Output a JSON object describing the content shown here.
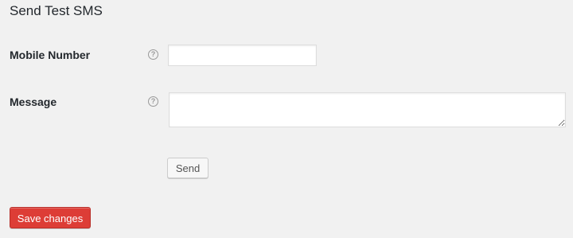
{
  "section": {
    "title": "Send Test SMS"
  },
  "fields": {
    "mobile": {
      "label": "Mobile Number",
      "help": "?",
      "value": "",
      "placeholder": ""
    },
    "message": {
      "label": "Message",
      "help": "?",
      "value": "",
      "placeholder": ""
    }
  },
  "actions": {
    "send_label": "Send",
    "save_label": "Save changes"
  },
  "colors": {
    "background": "#f1f1f1",
    "save_button": "#dd3d36",
    "text": "#23282d"
  },
  "icons": {
    "help": "help-circle-icon"
  }
}
